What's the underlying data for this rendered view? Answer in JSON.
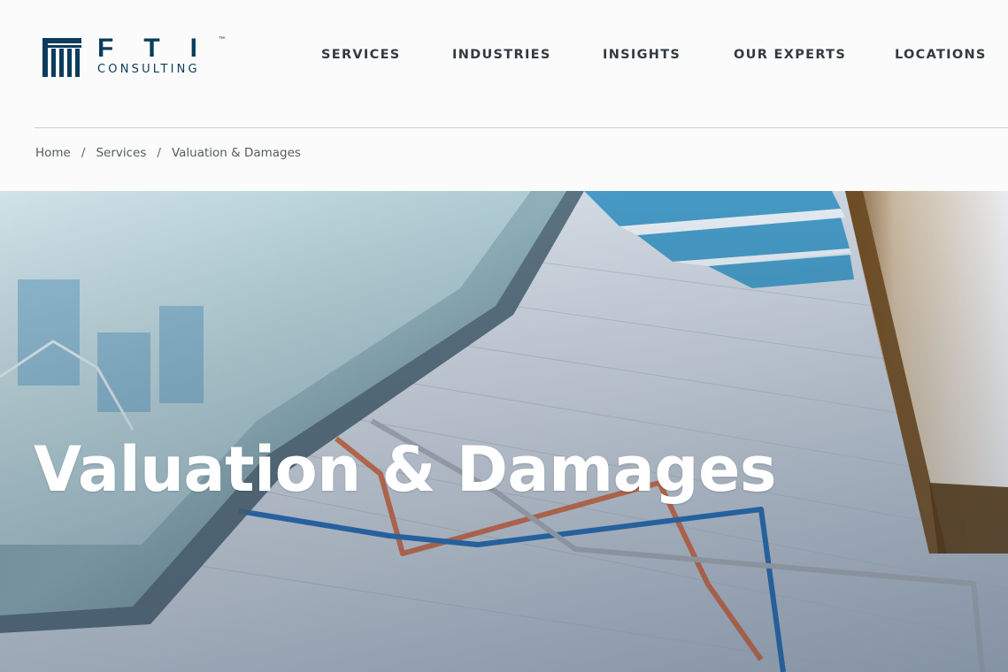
{
  "logo": {
    "wordmark": "FTI",
    "trademark": "™",
    "subtitle": "CONSULTING"
  },
  "nav": {
    "items": [
      {
        "label": "SERVICES"
      },
      {
        "label": "INDUSTRIES"
      },
      {
        "label": "INSIGHTS"
      },
      {
        "label": "OUR EXPERTS"
      },
      {
        "label": "LOCATIONS"
      }
    ]
  },
  "breadcrumb": {
    "items": [
      {
        "label": "Home"
      },
      {
        "label": "Services"
      },
      {
        "label": "Valuation & Damages"
      }
    ],
    "separator": "/"
  },
  "hero": {
    "title": "Valuation & Damages"
  },
  "colors": {
    "brand": "#0b3c5d",
    "nav_text": "#333a40",
    "hero_title": "#ffffff"
  }
}
